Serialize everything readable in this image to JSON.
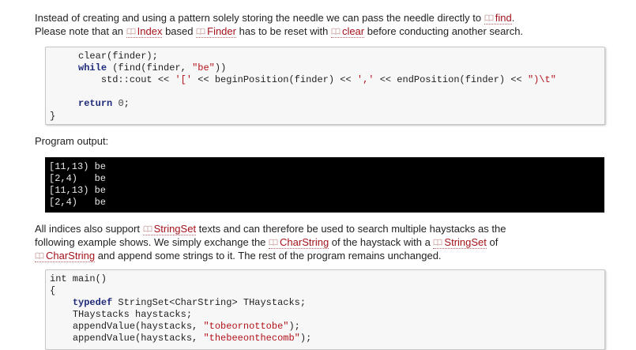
{
  "para1": {
    "l1_pre": "Instead of creating and using a pattern solely storing the needle we can pass the needle directly to ",
    "l1_link": "find",
    "l1_end": ".",
    "l2_pre": "Please note that an ",
    "l2_link1": "Index",
    "l2_mid1": " based ",
    "l2_link2": "Finder",
    "l2_mid2": " has to be reset with ",
    "l2_link3": "clear",
    "l2_end": " before conducting another search."
  },
  "code1": {
    "l1": "clear(finder);",
    "l2_kw": "while",
    "l2_a": " (find(finder, ",
    "l2_str": "\"be\"",
    "l2_b": "))",
    "l3_a": "std::cout << ",
    "l3_s1": "'['",
    "l3_b": " << beginPosition(finder) << ",
    "l3_s2": "','",
    "l3_c": " << endPosition(finder) << ",
    "l3_s3": "\")\\t\"",
    "l5_kw": "return",
    "l5_num": "0",
    "l5_end": ";",
    "closing": "}"
  },
  "output_label": "Program output:",
  "console_lines": [
    "[11,13) be",
    "[2,4)   be",
    "[11,13) be",
    "[2,4)   be"
  ],
  "para2": {
    "l1_pre": "All indices also support ",
    "l1_link": "StringSet",
    "l1_end": " texts and can therefore be used to search multiple haystacks as the",
    "l2_pre": "following example shows. We simply exchange the ",
    "l2_link1": "CharString",
    "l2_mid": " of the haystack with a ",
    "l2_link2": "StringSet",
    "l2_end": " of",
    "l3_link": "CharString",
    "l3_end": " and append some strings to it. The rest of the program remains unchanged."
  },
  "code2": {
    "l1": "int main()",
    "l2": "{",
    "l3_kw": "typedef",
    "l3_rest": " StringSet<CharString> THaystacks;",
    "l4": "THaystacks haystacks;",
    "l5_a": "appendValue(haystacks, ",
    "l5_str": "\"tobeornottobe\"",
    "l5_b": ");",
    "l6_a": "appendValue(haystacks, ",
    "l6_str": "\"thebeeonthecomb\"",
    "l6_b": ");"
  },
  "colors": {
    "link": "#a3121a",
    "keyword": "#1f2a7a",
    "string": "#b3131b",
    "console_bg": "#000000",
    "code_bg": "#f7f7f7"
  },
  "icons": {
    "link_icon": "book-icon"
  }
}
